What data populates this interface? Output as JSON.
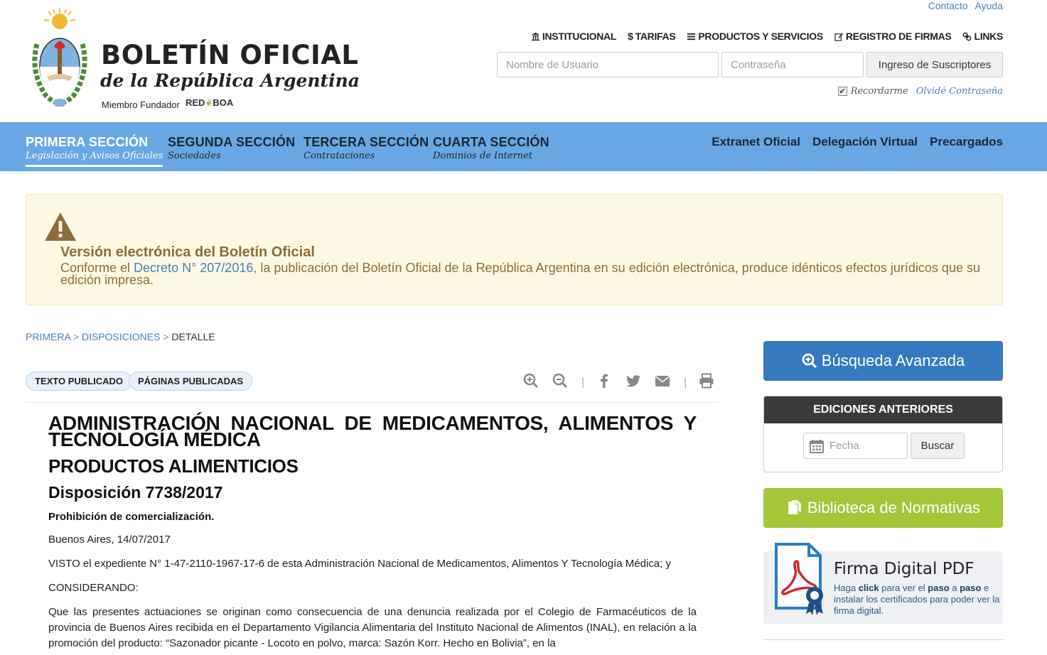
{
  "brand": {
    "title": "BOLETÍN OFICIAL",
    "subtitle": "de la República Argentina",
    "member": "Miembro Fundador",
    "red_logo": "RED",
    "boa_logo": "BOA"
  },
  "toplinks": {
    "contact": "Contacto",
    "help": "Ayuda"
  },
  "mainlinks": [
    {
      "icon": "bank-icon",
      "label": "INSTITUCIONAL"
    },
    {
      "icon": "dollar-icon",
      "label": "TARIFAS"
    },
    {
      "icon": "list-icon",
      "label": "PRODUCTOS Y SERVICIOS"
    },
    {
      "icon": "edit-icon",
      "label": "REGISTRO DE FIRMAS"
    },
    {
      "icon": "link-icon",
      "label": "LINKS"
    }
  ],
  "login": {
    "user_placeholder": "Nombre de Usuario",
    "pass_placeholder": "Contraseña",
    "button": "Ingreso de Suscriptores",
    "remember": "Recordarme",
    "remember_checked": true,
    "forgot": "Olvidé Contraseña"
  },
  "nav": {
    "sections": [
      {
        "title": "PRIMERA SECCIÓN",
        "sub": "Legislación y Avisos Oficiales",
        "active": true
      },
      {
        "title": "SEGUNDA SECCIÓN",
        "sub": "Sociedades",
        "active": false
      },
      {
        "title": "TERCERA SECCIÓN",
        "sub": "Contrataciones",
        "active": false
      },
      {
        "title": "CUARTA SECCIÓN",
        "sub": "Dominios de Internet",
        "active": false
      }
    ],
    "right": [
      "Extranet Oficial",
      "Delegación Virtual",
      "Precargados"
    ]
  },
  "notice": {
    "title": "Versión electrónica del Boletín Oficial",
    "text_before": "Conforme el ",
    "link": "Decreto N° 207/2016",
    "text_after": ", la publicación del Boletín Oficial de la República Argentina en su edición electrónica, produce idénticos efectos jurídicos que su edición impresa.",
    "color": "#fcf8e3"
  },
  "breadcrumb": {
    "items": [
      "PRIMERA",
      "DISPOSICIONES"
    ],
    "current": "DETALLE",
    "sep": ">"
  },
  "tabs": {
    "published_text": "TEXTO PUBLICADO",
    "published_pages": "PÁGINAS PUBLICADAS"
  },
  "tools": {
    "zoom_in": "zoom-in-icon",
    "zoom_out": "zoom-out-icon",
    "facebook": "facebook-icon",
    "twitter": "twitter-icon",
    "email": "envelope-icon",
    "print": "print-icon",
    "sep": "|"
  },
  "article": {
    "organism": "ADMINISTRACIÓN NACIONAL DE MEDICAMENTOS, ALIMENTOS Y TECNOLOGÍA MÉDICA",
    "category": "PRODUCTOS ALIMENTICIOS",
    "disposition": "Disposición 7738/2017",
    "summary": "Prohibición de comercialización.",
    "place_date": "Buenos Aires, 14/07/2017",
    "visto": "VISTO el expediente N° 1-47-2110-1967-17-6 de esta Administración Nacional de Medicamentos, Alimentos Y Tecnología Médica; y",
    "considerando": "CONSIDERANDO:",
    "body": "Que las presentes actuaciones se originan como consecuencia de una denuncia realizada por el Colegio de Farmacéuticos de la provincia de Buenos Aires recibida en el Departamento Vigilancia Alimentaria del Instituto Nacional de Alimentos (INAL), en relación a la promoción del producto: “Sazonador picante - Locoto en polvo, marca: Sazón Korr. Hecho en Bolivia”, en la"
  },
  "sidebar": {
    "advanced_search": "Búsqueda Avanzada",
    "editions_title": "EDICIONES ANTERIORES",
    "date_placeholder": "Fecha",
    "search_button": "Buscar",
    "library": "Biblioteca de Normativas",
    "firma_title": "Firma Digital PDF",
    "firma_1": "Haga ",
    "firma_click": "click",
    "firma_2": " para ver el ",
    "firma_paso": "paso",
    "firma_3": " a ",
    "firma_paso2": "paso",
    "firma_4": " e instalar los certificados para poder ver la firma digital.",
    "primary_color": "#3679bd",
    "library_color": "#a4c639",
    "nav_color": "#69a7e4"
  }
}
